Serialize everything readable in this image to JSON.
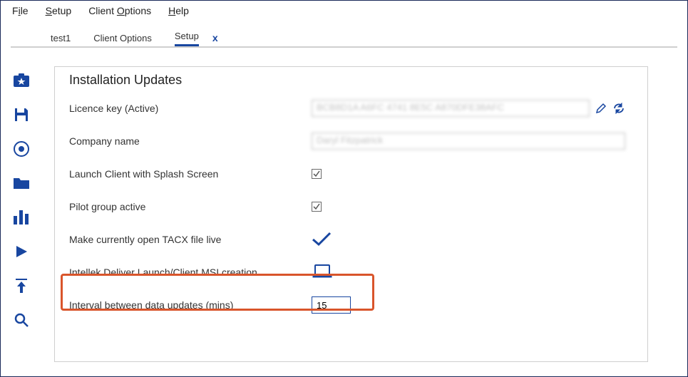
{
  "menubar": {
    "file": {
      "pre": "F",
      "u": "i",
      "post": "le"
    },
    "setup": {
      "pre": "",
      "u": "S",
      "post": "etup"
    },
    "options": {
      "pre": "Client ",
      "u": "O",
      "post": "ptions"
    },
    "help": {
      "pre": "",
      "u": "H",
      "post": "elp"
    }
  },
  "tabs": {
    "t0": "test1",
    "t1": "Client Options",
    "t2": "Setup",
    "close": "x"
  },
  "panel": {
    "title": "Installation Updates",
    "licence_label": "Licence key (Active)",
    "licence_value": "BCB8D1A A6FC 4741 8E5C A870DFE38AFC",
    "company_label": "Company name",
    "company_value": "Daryl Fitzpatrick",
    "splash_label": "Launch Client with Splash Screen",
    "pilot_label": "Pilot group active",
    "makelive_label": "Make currently open TACX file live",
    "msi_label": "Intellek Deliver Launch/Client MSI creation",
    "interval_label": "Interval between data updates (mins)",
    "interval_value": "15"
  }
}
